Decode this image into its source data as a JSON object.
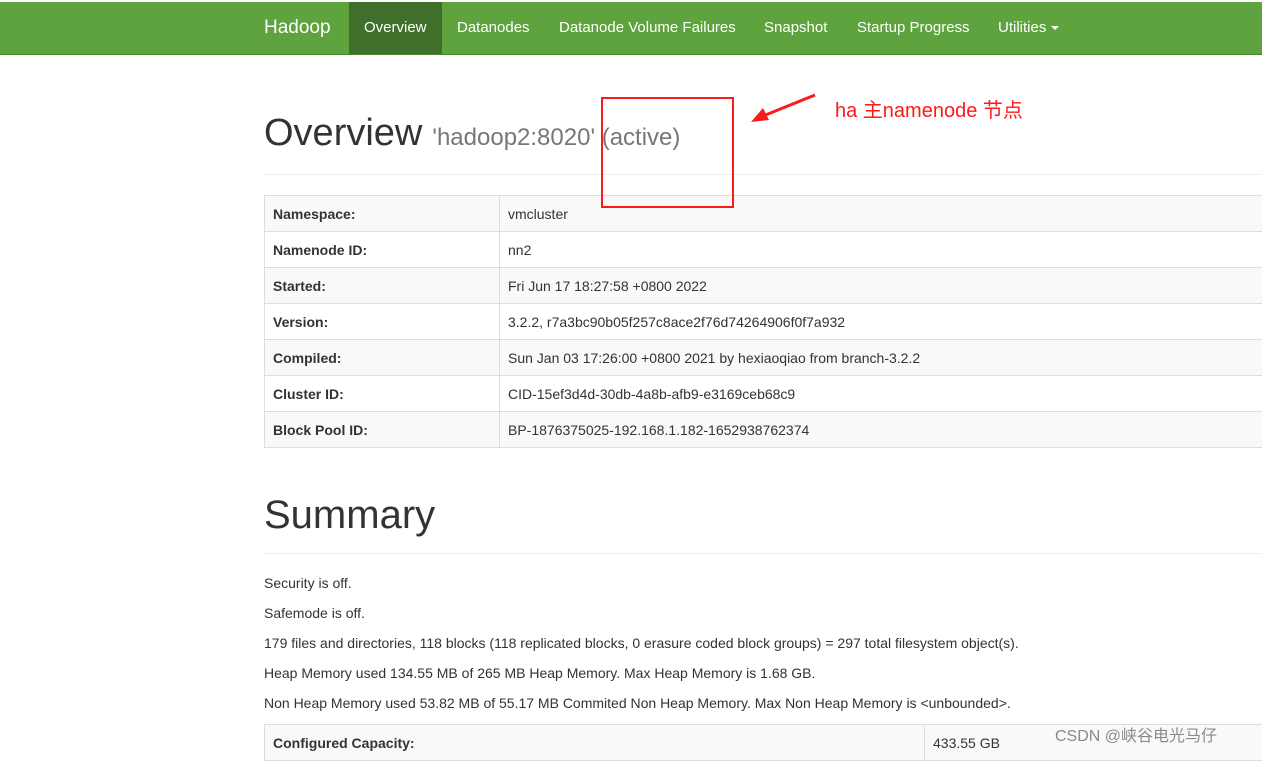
{
  "navbar": {
    "brand": "Hadoop",
    "items": [
      {
        "label": "Overview",
        "active": true
      },
      {
        "label": "Datanodes",
        "active": false
      },
      {
        "label": "Datanode Volume Failures",
        "active": false
      },
      {
        "label": "Snapshot",
        "active": false
      },
      {
        "label": "Startup Progress",
        "active": false
      },
      {
        "label": "Utilities",
        "active": false,
        "dropdown": true
      }
    ]
  },
  "overview": {
    "title": "Overview",
    "subtitle": "'hadoop2:8020' (active)",
    "rows": [
      {
        "key": "Namespace:",
        "value": "vmcluster"
      },
      {
        "key": "Namenode ID:",
        "value": "nn2"
      },
      {
        "key": "Started:",
        "value": "Fri Jun 17 18:27:58 +0800 2022"
      },
      {
        "key": "Version:",
        "value": "3.2.2, r7a3bc90b05f257c8ace2f76d74264906f0f7a932"
      },
      {
        "key": "Compiled:",
        "value": "Sun Jan 03 17:26:00 +0800 2021 by hexiaoqiao from branch-3.2.2"
      },
      {
        "key": "Cluster ID:",
        "value": "CID-15ef3d4d-30db-4a8b-afb9-e3169ceb68c9"
      },
      {
        "key": "Block Pool ID:",
        "value": "BP-1876375025-192.168.1.182-1652938762374"
      }
    ]
  },
  "summary": {
    "title": "Summary",
    "lines": [
      "Security is off.",
      "Safemode is off.",
      "179 files and directories, 118 blocks (118 replicated blocks, 0 erasure coded block groups) = 297 total filesystem object(s).",
      "Heap Memory used 134.55 MB of 265 MB Heap Memory. Max Heap Memory is 1.68 GB.",
      "Non Heap Memory used 53.82 MB of 55.17 MB Commited Non Heap Memory. Max Non Heap Memory is <unbounded>."
    ],
    "rows": [
      {
        "key": "Configured Capacity:",
        "value": "433.55 GB"
      }
    ]
  },
  "annotation": {
    "label": "ha 主namenode 节点",
    "color": "#ff1a1a"
  },
  "watermark": "CSDN @峡谷电光马仔",
  "colors": {
    "navbar": "#5fa33e",
    "navbar_active": "#3f6f2a"
  }
}
